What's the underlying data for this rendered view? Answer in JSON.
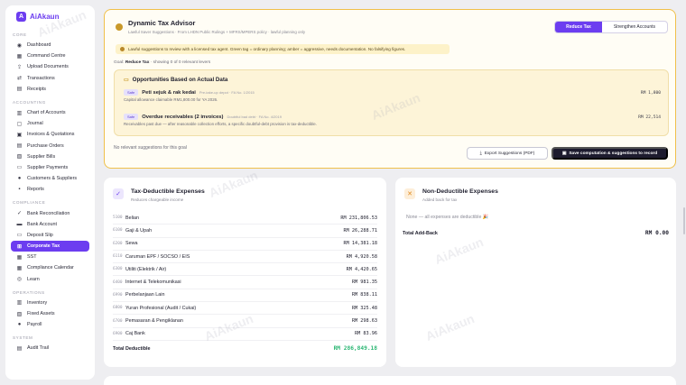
{
  "brand": {
    "name": "AiAkaun",
    "mark": "A"
  },
  "sidebar": {
    "sections": [
      {
        "label": "CORE",
        "items": [
          {
            "label": "Dashboard",
            "icon": "◉"
          },
          {
            "label": "Command Centre",
            "icon": "▦"
          },
          {
            "label": "Upload Documents",
            "icon": "⇪"
          },
          {
            "label": "Transactions",
            "icon": "⇄"
          },
          {
            "label": "Receipts",
            "icon": "▤"
          }
        ]
      },
      {
        "label": "ACCOUNTING",
        "items": [
          {
            "label": "Chart of Accounts",
            "icon": "▥"
          },
          {
            "label": "Journal",
            "icon": "▢"
          },
          {
            "label": "Invoices & Quotations",
            "icon": "▣"
          },
          {
            "label": "Purchase Orders",
            "icon": "▤"
          },
          {
            "label": "Supplier Bills",
            "icon": "▧"
          },
          {
            "label": "Supplier Payments",
            "icon": "▭"
          },
          {
            "label": "Customers & Suppliers",
            "icon": "●"
          },
          {
            "label": "Reports",
            "icon": "▪"
          }
        ]
      },
      {
        "label": "COMPLIANCE",
        "items": [
          {
            "label": "Bank Reconciliation",
            "icon": "✓"
          },
          {
            "label": "Bank Account",
            "icon": "▬"
          },
          {
            "label": "Deposit Slip",
            "icon": "▭"
          },
          {
            "label": "Corporate Tax",
            "icon": "⊞",
            "active": true
          },
          {
            "label": "SST",
            "icon": "▦"
          },
          {
            "label": "Compliance Calendar",
            "icon": "▦"
          },
          {
            "label": "Learn",
            "icon": "◎"
          }
        ]
      },
      {
        "label": "OPERATIONS",
        "items": [
          {
            "label": "Inventory",
            "icon": "▥"
          },
          {
            "label": "Fixed Assets",
            "icon": "▧"
          },
          {
            "label": "Payroll",
            "icon": "●"
          }
        ]
      },
      {
        "label": "SYSTEM",
        "items": [
          {
            "label": "Audit Trail",
            "icon": "▤"
          }
        ]
      }
    ]
  },
  "advisor": {
    "title": "Dynamic Tax Advisor",
    "subtitle": "Lawful Saver Suggestions · From LHDN Public Rulings + MFRS/MPERS policy · lawful planning only",
    "toggle": {
      "active": "Reduce Tax",
      "inactive": "Strengthen Accounts"
    },
    "warning": "Lawful suggestions to review with a licensed tax agent. Green tag = ordinary planning; amber = aggressive, needs documentation. No falsifying figures.",
    "goal_prefix": "Goal:",
    "goal_value": "Reduce Tax",
    "goal_suffix": "· showing 0 of 0 relevant levers",
    "opportunities": {
      "title": "Opportunities Based on Actual Data",
      "items": [
        {
          "tag": "Safe",
          "name": "Peti sejuk & rak kedai",
          "basis": "Pre-take-up depot · FA No. 1/2015",
          "detail": "Capital allowance claimable RM1,800.00 for YA 2026.",
          "amount": "RM 1,800"
        },
        {
          "tag": "Safe",
          "name": "Overdue receivables (2 invoices)",
          "basis": "Doubtful bad debt · FA No. 4/2019",
          "detail": "Receivables past due — after reasonable collection efforts, a specific doubtful-debt provision is tax-deductible.",
          "amount": "RM 22,514"
        }
      ]
    },
    "no_relevant": "No relevant suggestions for this goal",
    "export_label": "Export Suggestions (PDF)",
    "save_label": "Save computation & suggestions to record"
  },
  "deductible": {
    "title": "Tax-Deductible Expenses",
    "subtitle": "Reduces chargeable income",
    "rows": [
      {
        "code": "5100",
        "name": "Belian",
        "amount": "RM 231,806.53"
      },
      {
        "code": "6100",
        "name": "Gaji & Upah",
        "amount": "RM 26,288.71"
      },
      {
        "code": "6200",
        "name": "Sewa",
        "amount": "RM 14,381.18"
      },
      {
        "code": "6110",
        "name": "Caruman EPF / SOCSO / EIS",
        "amount": "RM 4,920.58"
      },
      {
        "code": "6300",
        "name": "Utiliti (Elektrik / Air)",
        "amount": "RM 4,420.65"
      },
      {
        "code": "6400",
        "name": "Internet & Telekomunikasi",
        "amount": "RM 981.35"
      },
      {
        "code": "6990",
        "name": "Perbelanjaan Lain",
        "amount": "RM 838.11"
      },
      {
        "code": "6800",
        "name": "Yuran Profesional (Audit / Cukai)",
        "amount": "RM 325.48"
      },
      {
        "code": "6700",
        "name": "Pemasaran & Pengiklanan",
        "amount": "RM 298.63"
      },
      {
        "code": "6900",
        "name": "Caj Bank",
        "amount": "RM 83.96"
      }
    ],
    "total_label": "Total Deductible",
    "total_amount": "RM 286,849.18"
  },
  "non_deductible": {
    "title": "Non-Deductible Expenses",
    "subtitle": "Added back for tax",
    "none_text": "None — all expenses are deductible 🎉",
    "total_label": "Total Add-Back",
    "total_amount": "RM 0.00"
  },
  "watermark": "AiAkaun"
}
